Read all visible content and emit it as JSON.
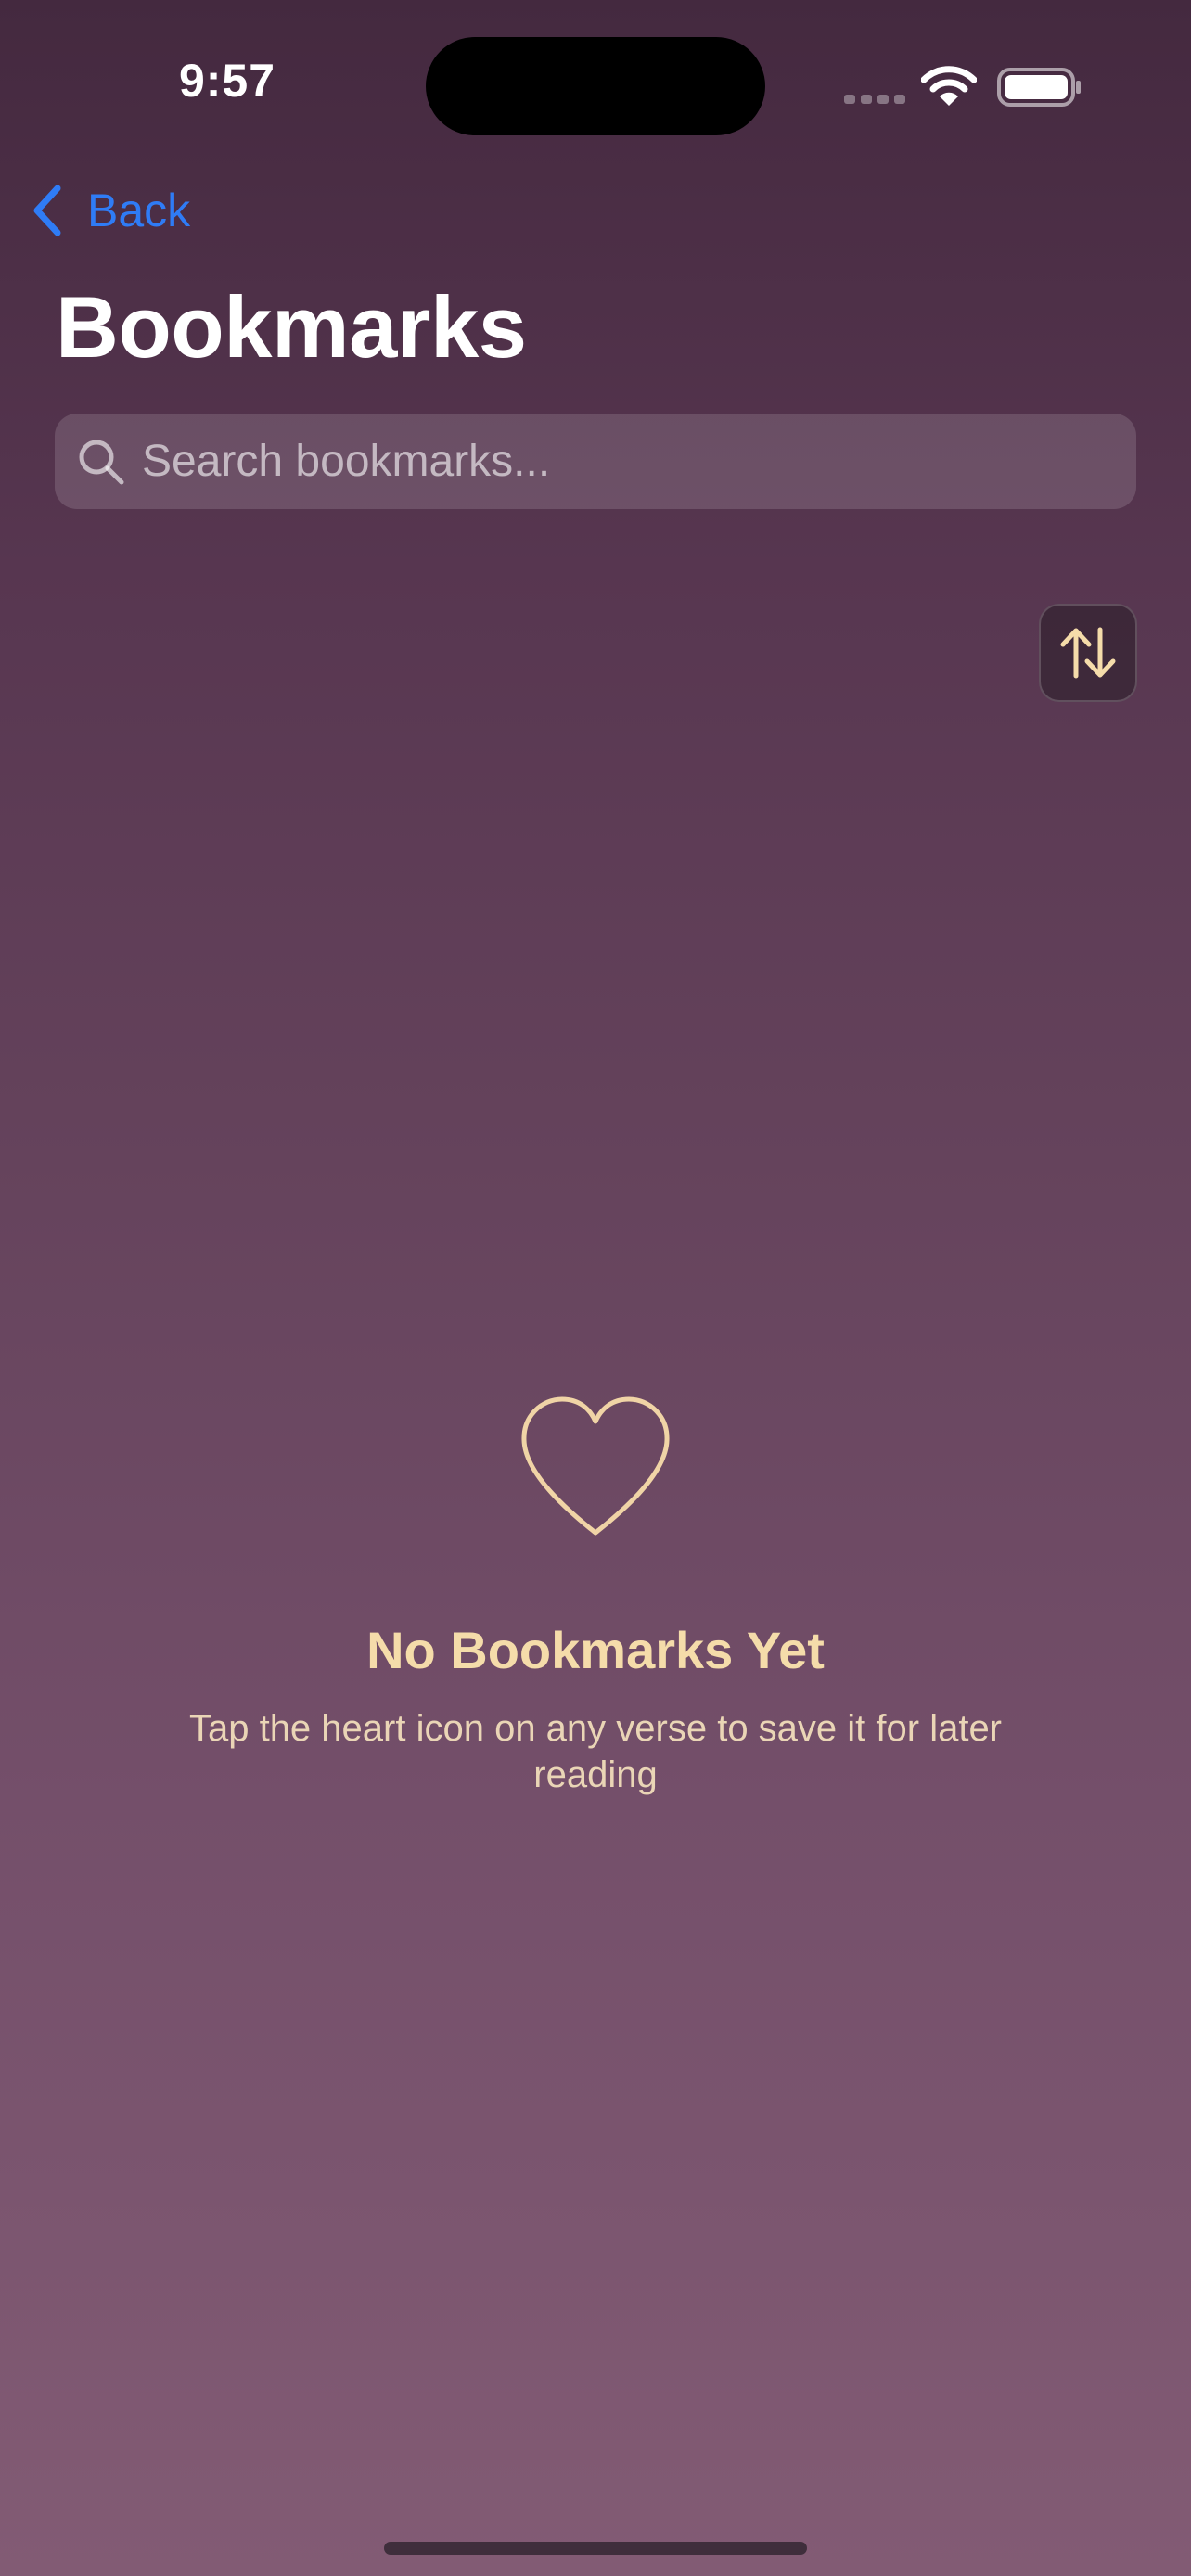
{
  "status_bar": {
    "time": "9:57",
    "icons": [
      "cellular-signal-icon",
      "wifi-icon",
      "battery-icon"
    ]
  },
  "navigation": {
    "back_label": "Back",
    "back_icon": "chevron-left-icon",
    "title": "Bookmarks"
  },
  "search": {
    "placeholder": "Search bookmarks...",
    "value": "",
    "icon": "search-icon"
  },
  "sort": {
    "icon": "sort-arrows-icon"
  },
  "empty_state": {
    "icon": "heart-outline-icon",
    "title": "No Bookmarks Yet",
    "message": "Tap the heart icon on any verse to save it for later reading"
  },
  "colors": {
    "accent_blue": "#2f7cf6",
    "gold": "#f5dcaa",
    "gold_soft": "#ead5b6",
    "background_top": "#44293f",
    "background_bottom": "#825b74"
  }
}
